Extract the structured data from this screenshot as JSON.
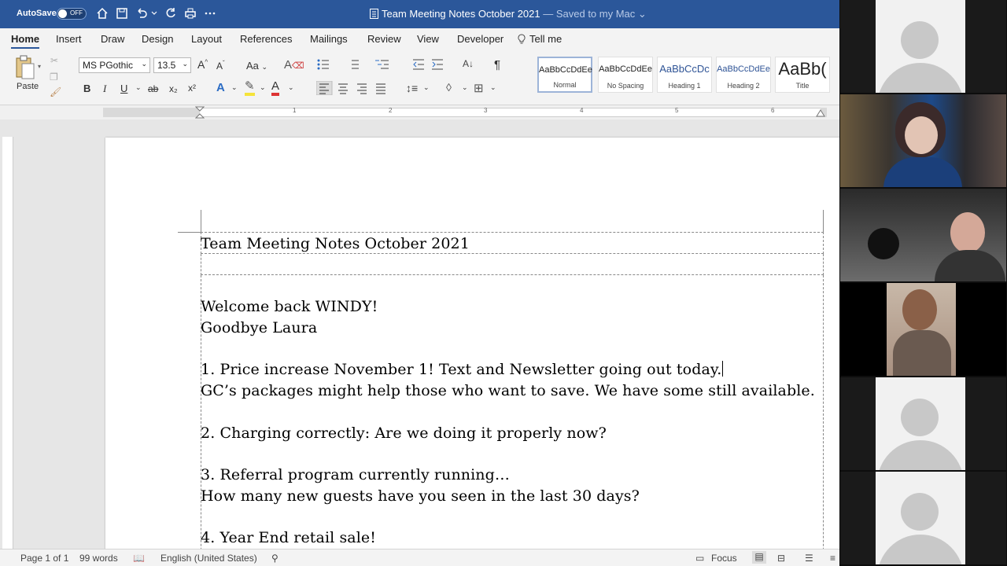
{
  "titlebar": {
    "autosave_label": "AutoSave",
    "autosave_state": "OFF",
    "document_name": "Team Meeting Notes October 2021",
    "saved_status": "— Saved to my Mac"
  },
  "tabs": [
    "Home",
    "Insert",
    "Draw",
    "Design",
    "Layout",
    "References",
    "Mailings",
    "Review",
    "View",
    "Developer",
    "Tell me"
  ],
  "ribbon": {
    "paste_label": "Paste",
    "font_name": "MS PGothic",
    "font_size": "13.5",
    "change_case": "Aa",
    "bold": "B",
    "italic": "I",
    "underline": "U",
    "strike": "ab",
    "subscript": "x₂",
    "superscript": "x²",
    "pilcrow": "¶",
    "styles": [
      {
        "preview": "AaBbCcDdEe",
        "name": "Normal"
      },
      {
        "preview": "AaBbCcDdEe",
        "name": "No Spacing"
      },
      {
        "preview": "AaBbCcDc",
        "name": "Heading 1"
      },
      {
        "preview": "AaBbCcDdEe",
        "name": "Heading 2"
      },
      {
        "preview": "AaBb(",
        "name": "Title"
      }
    ]
  },
  "ruler_numbers": [
    "1",
    "2",
    "3",
    "4",
    "5",
    "6"
  ],
  "document": {
    "header": "Team Meeting Notes October 2021",
    "lines": [
      "Welcome back WINDY!",
      "Goodbye Laura",
      "1. Price increase November 1!  Text and Newsletter going out today.",
      "GC’s packages might help those who want to save.  We have some still available.",
      "2. Charging correctly: Are we doing it properly now?",
      "3. Referral program currently running…",
      "How many new guests have you seen in the last 30 days?",
      "4. Year End retail sale!"
    ]
  },
  "status": {
    "page": "Page 1 of 1",
    "words": "99 words",
    "language": "English (United States)",
    "focus": "Focus"
  },
  "colors": {
    "word_blue": "#2b579a",
    "ribbon_bg": "#f3f3f3",
    "canvas_bg": "#e6e6e6"
  }
}
